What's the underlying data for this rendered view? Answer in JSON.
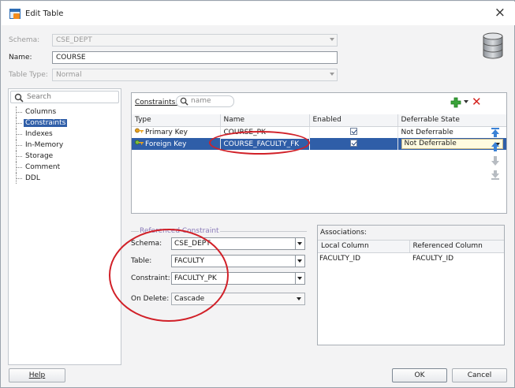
{
  "window": {
    "title": "Edit Table",
    "close_glyph": "×"
  },
  "form": {
    "schema_label": "Schema:",
    "schema_value": "CSE_DEPT",
    "name_label": "Name:",
    "name_value": "COURSE",
    "table_type_label": "Table Type:",
    "table_type_value": "Normal"
  },
  "sidebar": {
    "search_placeholder": "Search",
    "items": [
      {
        "label": "Columns"
      },
      {
        "label": "Constraints",
        "selected": true
      },
      {
        "label": "Indexes"
      },
      {
        "label": "In-Memory"
      },
      {
        "label": "Storage"
      },
      {
        "label": "Comment"
      },
      {
        "label": "DDL"
      }
    ]
  },
  "constraints": {
    "label": "Constraints:",
    "search_placeholder": "name",
    "columns": [
      "Type",
      "Name",
      "Enabled",
      "Deferrable State"
    ],
    "rows": [
      {
        "type": "Primary Key",
        "name": "COURSE_PK",
        "enabled": true,
        "deferrable": "Not Deferrable",
        "icon": "primary-key-icon"
      },
      {
        "type": "Foreign Key",
        "name": "COURSE_FACULTY_FK",
        "enabled": true,
        "deferrable": "Not Deferrable",
        "icon": "foreign-key-icon",
        "selected": true
      }
    ]
  },
  "referenced": {
    "legend": "Referenced Constraint",
    "schema_label": "Schema:",
    "schema_value": "CSE_DEPT",
    "table_label": "Table:",
    "table_value": "FACULTY",
    "constraint_label": "Constraint:",
    "constraint_value": "FACULTY_PK",
    "on_delete_label": "On Delete:",
    "on_delete_value": "Cascade"
  },
  "associations": {
    "label": "Associations:",
    "columns": [
      "Local Column",
      "Referenced Column"
    ],
    "rows": [
      {
        "local": "FACULTY_ID",
        "referenced": "FACULTY_ID"
      }
    ]
  },
  "buttons": {
    "help": "Help",
    "ok": "OK",
    "cancel": "Cancel"
  },
  "colors": {
    "selection": "#2f5ea8",
    "annotation": "#d12028",
    "add": "#3aa33a",
    "delete": "#d4231e"
  }
}
